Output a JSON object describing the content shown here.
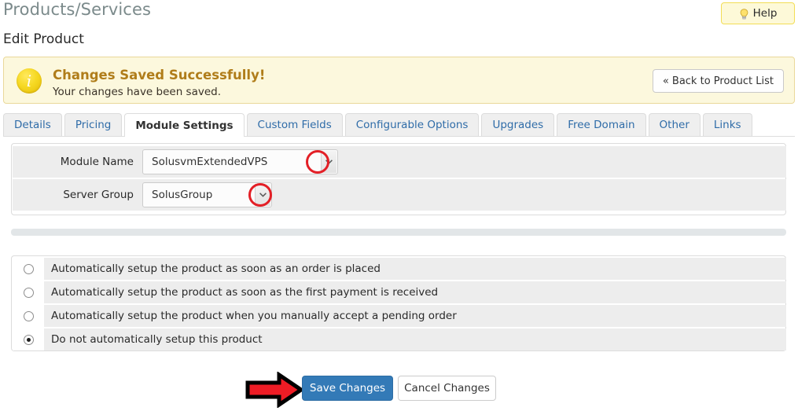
{
  "header": {
    "page_title": "Products/Services",
    "subtitle": "Edit Product",
    "help_label": "Help",
    "help_icon": "lightbulb-icon"
  },
  "alert": {
    "icon": "info-circle-icon",
    "title": "Changes Saved Successfully!",
    "text": "Your changes have been saved.",
    "back_button_label": "« Back to Product List",
    "background_color": "#fcf8dd",
    "border_color": "#ead89a",
    "title_color": "#b07d1a"
  },
  "tabs": [
    {
      "label": "Details",
      "active": false
    },
    {
      "label": "Pricing",
      "active": false
    },
    {
      "label": "Module Settings",
      "active": true
    },
    {
      "label": "Custom Fields",
      "active": false
    },
    {
      "label": "Configurable Options",
      "active": false
    },
    {
      "label": "Upgrades",
      "active": false
    },
    {
      "label": "Free Domain",
      "active": false
    },
    {
      "label": "Other",
      "active": false
    },
    {
      "label": "Links",
      "active": false
    }
  ],
  "module_settings": {
    "fields": [
      {
        "label": "Module Name",
        "value": "SolusvmExtendedVPS",
        "icon": "chevron-down-icon"
      },
      {
        "label": "Server Group",
        "value": "SolusGroup",
        "icon": "chevron-down-icon"
      }
    ]
  },
  "annotations": {
    "ring_color": "#e31f26",
    "arrow_color": "#ee1c25",
    "arrow_outline_color": "#000000"
  },
  "setup_options": {
    "items": [
      {
        "label": "Automatically setup the product as soon as an order is placed",
        "selected": false
      },
      {
        "label": "Automatically setup the product as soon as the first payment is received",
        "selected": false
      },
      {
        "label": "Automatically setup the product when you manually accept a pending order",
        "selected": false
      },
      {
        "label": "Do not automatically setup this product",
        "selected": true
      }
    ]
  },
  "footer": {
    "save_label": "Save Changes",
    "cancel_label": "Cancel Changes",
    "save_color": "#337ab7"
  }
}
